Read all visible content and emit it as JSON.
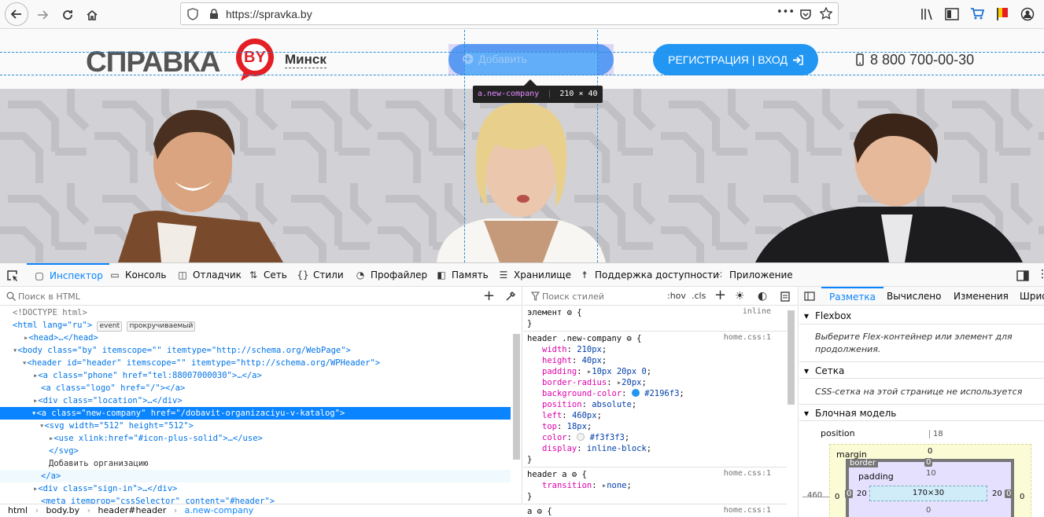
{
  "browser": {
    "url": "https://spravka.by",
    "more_label": "•••"
  },
  "site": {
    "logo_text": "СПРАВКА",
    "logo_badge": "BY",
    "city": "Минск",
    "add_button": "Добавить",
    "register_button": "РЕГИСТРАЦИЯ | ВХОД",
    "phone": "8 800 700-00-30",
    "tooltip_selector": "a.new-company",
    "tooltip_size": "210 × 40",
    "colors": {
      "accent": "#2196f3",
      "logo_red": "#e31e24",
      "logo_gray": "#555555"
    }
  },
  "devtools": {
    "tabs": [
      "Инспектор",
      "Консоль",
      "Отладчик",
      "Сеть",
      "Стили",
      "Профайлер",
      "Память",
      "Хранилище",
      "Поддержка доступности",
      "Приложение"
    ],
    "tab_icons": [
      "inspector-icon",
      "console-icon",
      "debugger-icon",
      "network-icon",
      "style-editor-icon",
      "profiler-icon",
      "memory-icon",
      "storage-icon",
      "accessibility-icon",
      "application-icon"
    ],
    "active_tab": "Инспектор",
    "html_search_placeholder": "Поиск в HTML",
    "styles_search_placeholder": "Поиск стилей",
    "hov_label": ":hov",
    "cls_label": ".cls",
    "markup": [
      {
        "text": "<!DOCTYPE html>"
      },
      {
        "text": "<html lang=\"ru\">",
        "badges": [
          "event",
          "прокручиваемый"
        ]
      },
      {
        "text": "<head>…</head>"
      },
      {
        "text": "<body class=\"by\" itemscope=\"\" itemtype=\"http://schema.org/WebPage\">"
      },
      {
        "text": "<header id=\"header\" itemscope=\"\" itemtype=\"http://schema.org/WPHeader\">"
      },
      {
        "text": "<a class=\"phone\" href=\"tel:88007000030\">…</a>"
      },
      {
        "text": "<a class=\"logo\" href=\"/\"></a>"
      },
      {
        "text": "<div class=\"location\">…</div>"
      },
      {
        "text": "<a class=\"new-company\" href=\"/dobavit-organizaciyu-v-katalog\">"
      },
      {
        "text": "<svg width=\"512\" height=\"512\">"
      },
      {
        "text": "<use xlink:href=\"#icon-plus-solid\">…</use>"
      },
      {
        "text": "</svg>"
      },
      {
        "text": "Добавить организацию"
      },
      {
        "text": "</a>"
      },
      {
        "text": "<div class=\"sign-in\">…</div>"
      },
      {
        "text": "<meta itemprop=\"cssSelector\" content=\"#header\">"
      }
    ],
    "breadcrumbs": [
      "html",
      "body.by",
      "header#header",
      "a.new-company"
    ],
    "rules": {
      "element_selector": "элемент",
      "element_source": "inline",
      "rule1_selector": "header .new-company",
      "rule1_source": "home.css:1",
      "rule1_props": [
        {
          "name": "width",
          "value": "210px"
        },
        {
          "name": "height",
          "value": "40px"
        },
        {
          "name": "padding",
          "value": "10px 20px 0"
        },
        {
          "name": "border-radius",
          "value": "20px"
        },
        {
          "name": "background-color",
          "value": "#2196f3"
        },
        {
          "name": "position",
          "value": "absolute"
        },
        {
          "name": "left",
          "value": "460px"
        },
        {
          "name": "top",
          "value": "18px"
        },
        {
          "name": "color",
          "value": "#f3f3f3"
        },
        {
          "name": "display",
          "value": "inline-block"
        }
      ],
      "rule2_selector": "header a",
      "rule2_source": "home.css:1",
      "rule2_props": [
        {
          "name": "transition",
          "value": "none"
        }
      ],
      "rule3_selector": "a",
      "rule3_source": "home.css:1"
    },
    "layout": {
      "tabs": [
        "Разметка",
        "Вычислено",
        "Изменения",
        "Шрифт"
      ],
      "flexbox_title": "Flexbox",
      "flexbox_note": "Выберите Flex-контейнер или элемент для продолжения.",
      "grid_title": "Сетка",
      "grid_note": "CSS-сетка на этой странице не используется",
      "boxmodel_title": "Блочная модель",
      "position_label": "position",
      "position_top": "18",
      "position_left": "460",
      "margin_label": "margin",
      "margin_top": "0",
      "margin_left": "0",
      "margin_right": "0",
      "border_label": "border",
      "border_top": "0",
      "border_left": "0",
      "border_right": "0",
      "padding_label": "padding",
      "padding_top": "10",
      "padding_left": "20",
      "padding_right": "20",
      "padding_bottom": "0",
      "content_size": "170×30"
    }
  }
}
